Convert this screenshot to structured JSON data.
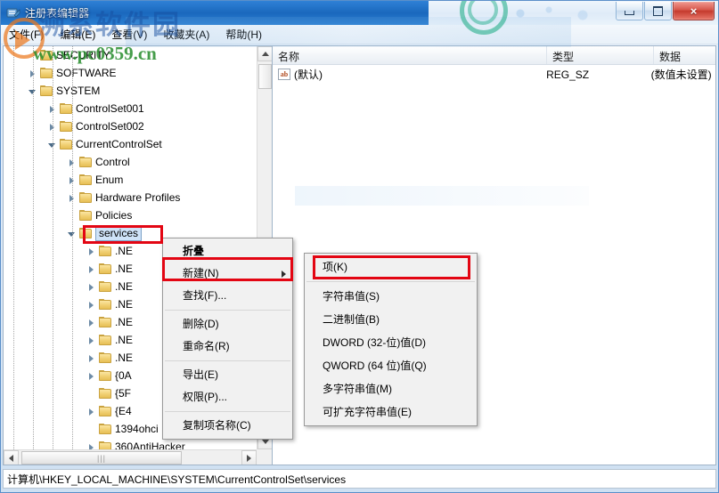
{
  "window": {
    "title": "注册表编辑器",
    "app_icon": "registry-editor-icon",
    "minimize_label": "最小化",
    "maximize_label": "最大化",
    "close_label": "×"
  },
  "menubar": {
    "items": [
      {
        "label": "文件(F)",
        "name": "file"
      },
      {
        "label": "编辑(E)",
        "name": "edit"
      },
      {
        "label": "查看(V)",
        "name": "view"
      },
      {
        "label": "收藏夹(A)",
        "name": "favorites"
      },
      {
        "label": "帮助(H)",
        "name": "help"
      }
    ]
  },
  "tree": {
    "nodes": [
      {
        "label": "SECURITY",
        "indent": 1,
        "expander": "none",
        "selected": false
      },
      {
        "label": "SOFTWARE",
        "indent": 1,
        "expander": "closed",
        "selected": false
      },
      {
        "label": "SYSTEM",
        "indent": 1,
        "expander": "open",
        "selected": false
      },
      {
        "label": "ControlSet001",
        "indent": 2,
        "expander": "closed",
        "selected": false
      },
      {
        "label": "ControlSet002",
        "indent": 2,
        "expander": "closed",
        "selected": false
      },
      {
        "label": "CurrentControlSet",
        "indent": 2,
        "expander": "open",
        "selected": false
      },
      {
        "label": "Control",
        "indent": 3,
        "expander": "closed",
        "selected": false
      },
      {
        "label": "Enum",
        "indent": 3,
        "expander": "closed",
        "selected": false
      },
      {
        "label": "Hardware Profiles",
        "indent": 3,
        "expander": "closed",
        "selected": false
      },
      {
        "label": "Policies",
        "indent": 3,
        "expander": "none",
        "selected": false
      },
      {
        "label": "services",
        "indent": 3,
        "expander": "open",
        "selected": true
      },
      {
        "label": ".NE",
        "indent": 4,
        "expander": "closed",
        "selected": false
      },
      {
        "label": ".NE",
        "indent": 4,
        "expander": "closed",
        "selected": false
      },
      {
        "label": ".NE",
        "indent": 4,
        "expander": "closed",
        "selected": false
      },
      {
        "label": ".NE",
        "indent": 4,
        "expander": "closed",
        "selected": false
      },
      {
        "label": ".NE",
        "indent": 4,
        "expander": "closed",
        "selected": false
      },
      {
        "label": ".NE",
        "indent": 4,
        "expander": "closed",
        "selected": false
      },
      {
        "label": ".NE",
        "indent": 4,
        "expander": "closed",
        "selected": false
      },
      {
        "label": "{0A",
        "indent": 4,
        "expander": "closed",
        "selected": false
      },
      {
        "label": "{5F",
        "indent": 4,
        "expander": "none",
        "selected": false
      },
      {
        "label": "{E4",
        "indent": 4,
        "expander": "closed",
        "selected": false
      },
      {
        "label": "1394ohci",
        "indent": 4,
        "expander": "none",
        "selected": false
      },
      {
        "label": "360AntiHacker",
        "indent": 4,
        "expander": "closed",
        "selected": false
      }
    ]
  },
  "list": {
    "columns": [
      "名称",
      "类型",
      "数据"
    ],
    "rows": [
      {
        "icon": "ab-string-icon",
        "name": "(默认)",
        "type": "REG_SZ",
        "data": "(数值未设置)"
      }
    ]
  },
  "context_menu": {
    "items": [
      {
        "label": "折叠",
        "bold": true,
        "submenu": false,
        "separator_after": false
      },
      {
        "label": "新建(N)",
        "bold": false,
        "submenu": true,
        "separator_after": false
      },
      {
        "label": "查找(F)...",
        "bold": false,
        "submenu": false,
        "separator_after": true
      },
      {
        "label": "删除(D)",
        "bold": false,
        "submenu": false,
        "separator_after": false
      },
      {
        "label": "重命名(R)",
        "bold": false,
        "submenu": false,
        "separator_after": true
      },
      {
        "label": "导出(E)",
        "bold": false,
        "submenu": false,
        "separator_after": false
      },
      {
        "label": "权限(P)...",
        "bold": false,
        "submenu": false,
        "separator_after": true
      },
      {
        "label": "复制项名称(C)",
        "bold": false,
        "submenu": false,
        "separator_after": false
      }
    ]
  },
  "submenu": {
    "items": [
      {
        "label": "项(K)",
        "separator_after": true
      },
      {
        "label": "字符串值(S)",
        "separator_after": false
      },
      {
        "label": "二进制值(B)",
        "separator_after": false
      },
      {
        "label": "DWORD (32-位)值(D)",
        "separator_after": false
      },
      {
        "label": "QWORD (64 位)值(Q)",
        "separator_after": false
      },
      {
        "label": "多字符串值(M)",
        "separator_after": false
      },
      {
        "label": "可扩充字符串值(E)",
        "separator_after": false
      }
    ]
  },
  "statusbar": {
    "path": "计算机\\HKEY_LOCAL_MACHINE\\SYSTEM\\CurrentControlSet\\services"
  },
  "watermark": {
    "url": "www.pc0359.cn",
    "site": "溯系软件园"
  },
  "colors": {
    "annotation_red": "#e30613",
    "titlebar_blue": "#1d6cc0",
    "selection_blue": "#cfe3f8",
    "watermark_green": "#268c2c"
  },
  "scroll": {
    "tree_vertical": "tree-vertical-scrollbar",
    "tree_horizontal": "tree-horizontal-scrollbar"
  }
}
